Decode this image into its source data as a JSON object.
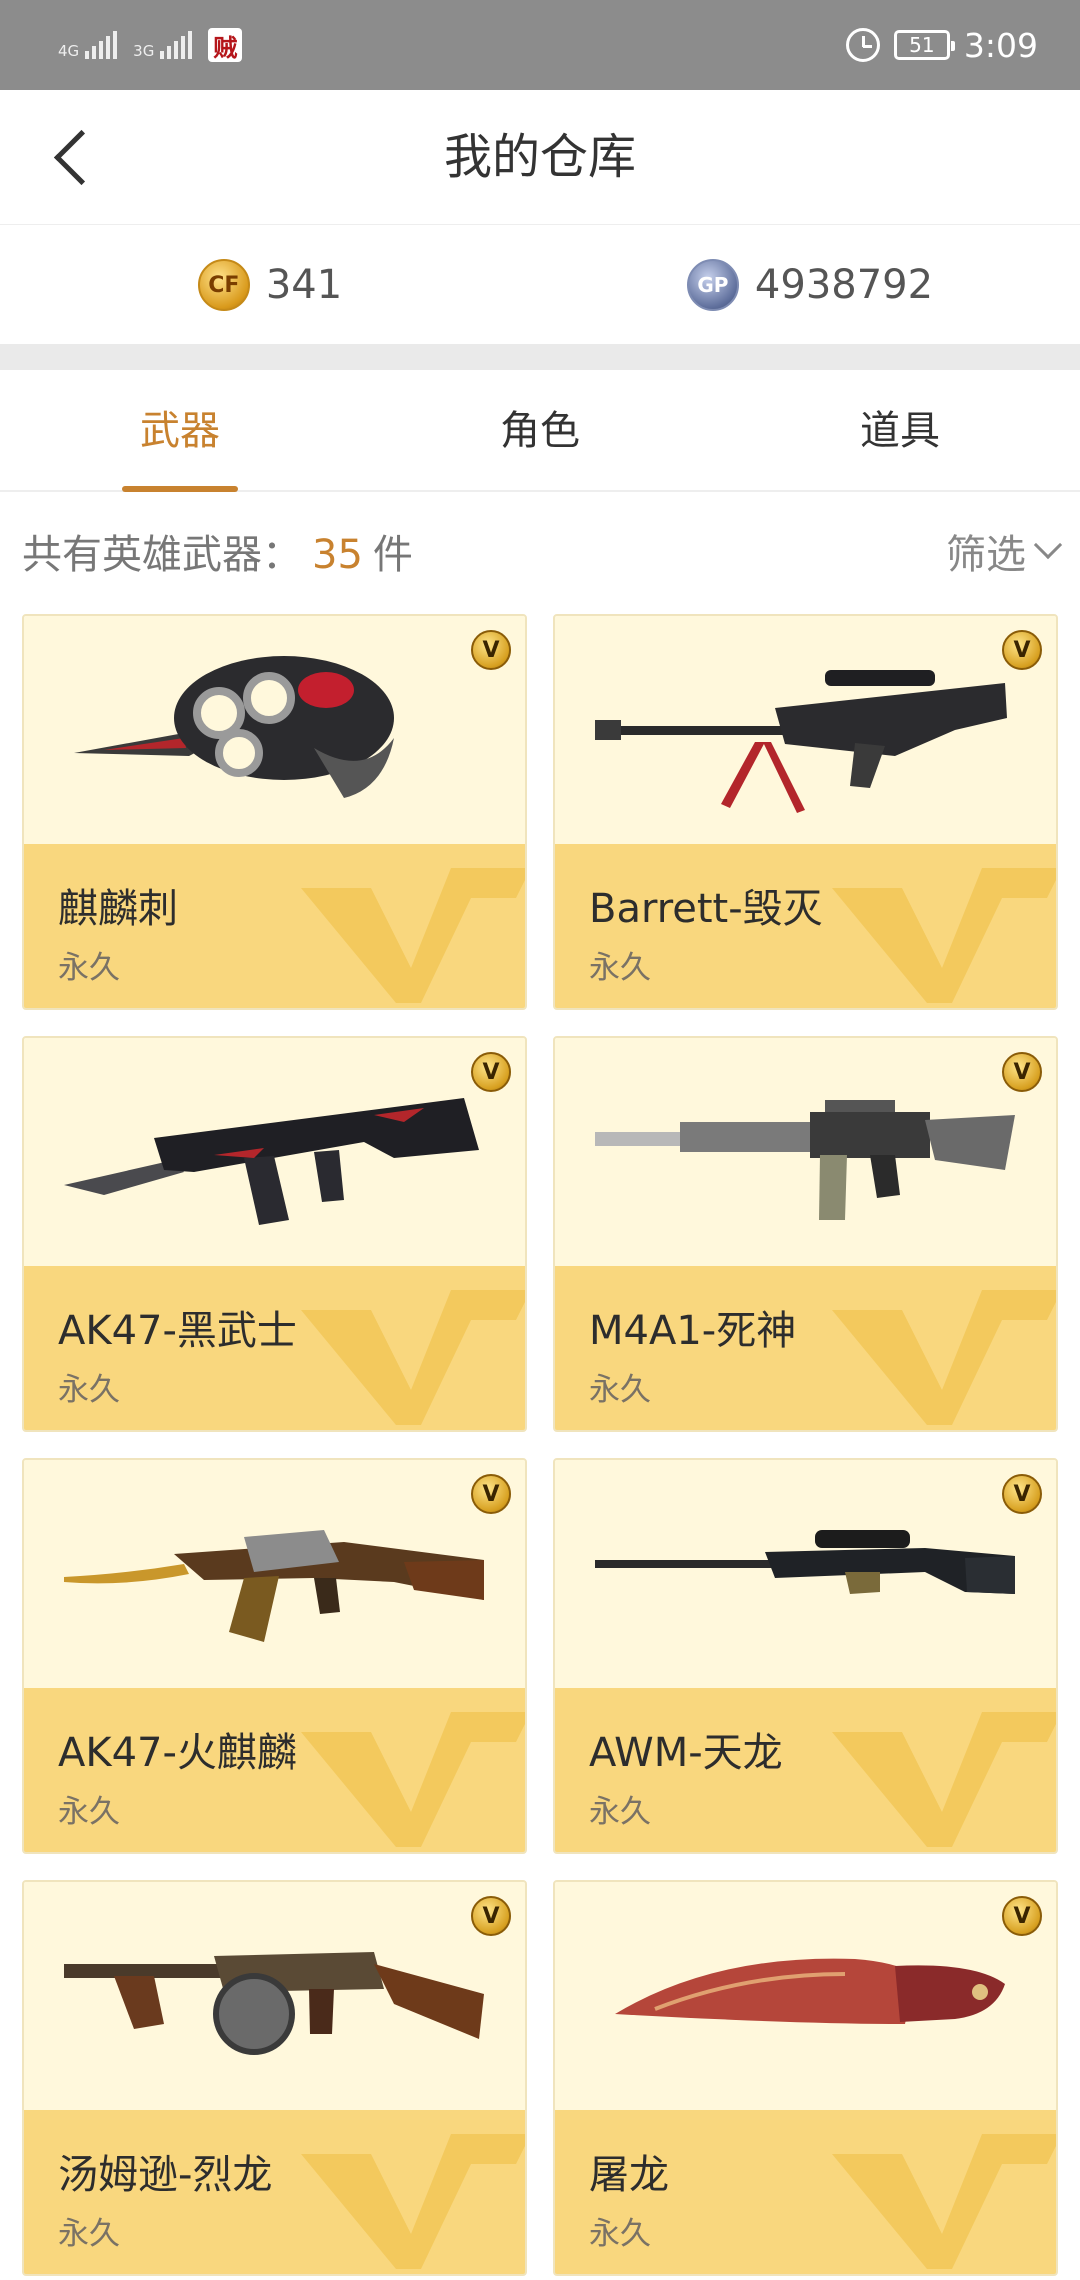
{
  "status_bar": {
    "sim1": "4G",
    "sim2": "3G",
    "app_badge": "贼",
    "battery": "51",
    "time": "3:09"
  },
  "header": {
    "title": "我的仓库"
  },
  "currency": {
    "cf_icon": "CF",
    "cf_amount": "341",
    "gp_icon": "GP",
    "gp_amount": "4938792"
  },
  "tabs": [
    {
      "label": "武器",
      "active": true
    },
    {
      "label": "角色",
      "active": false
    },
    {
      "label": "道具",
      "active": false
    }
  ],
  "summary": {
    "prefix": "共有英雄武器：",
    "count": "35",
    "unit": "件",
    "filter_label": "筛选"
  },
  "items": [
    {
      "name": "麒麟刺",
      "duration": "永久",
      "badge": "V",
      "icon": "knuckle-blade-icon"
    },
    {
      "name": "Barrett-毁灭",
      "duration": "永久",
      "badge": "V",
      "icon": "sniper-rifle-icon"
    },
    {
      "name": "AK47-黑武士",
      "duration": "永久",
      "badge": "V",
      "icon": "assault-rifle-icon"
    },
    {
      "name": "M4A1-死神",
      "duration": "永久",
      "badge": "V",
      "icon": "assault-rifle-icon"
    },
    {
      "name": "AK47-火麒麟",
      "duration": "永久",
      "badge": "V",
      "icon": "assault-rifle-icon"
    },
    {
      "name": "AWM-天龙",
      "duration": "永久",
      "badge": "V",
      "icon": "sniper-rifle-icon"
    },
    {
      "name": "汤姆逊-烈龙",
      "duration": "永久",
      "badge": "V",
      "icon": "smg-icon"
    },
    {
      "name": "屠龙",
      "duration": "永久",
      "badge": "V",
      "icon": "knife-icon"
    }
  ],
  "colors": {
    "accent": "#c8822f",
    "card_bottom": "#f9d77e",
    "card_top": "#fff8dc",
    "status_bar": "#8c8c8c"
  }
}
